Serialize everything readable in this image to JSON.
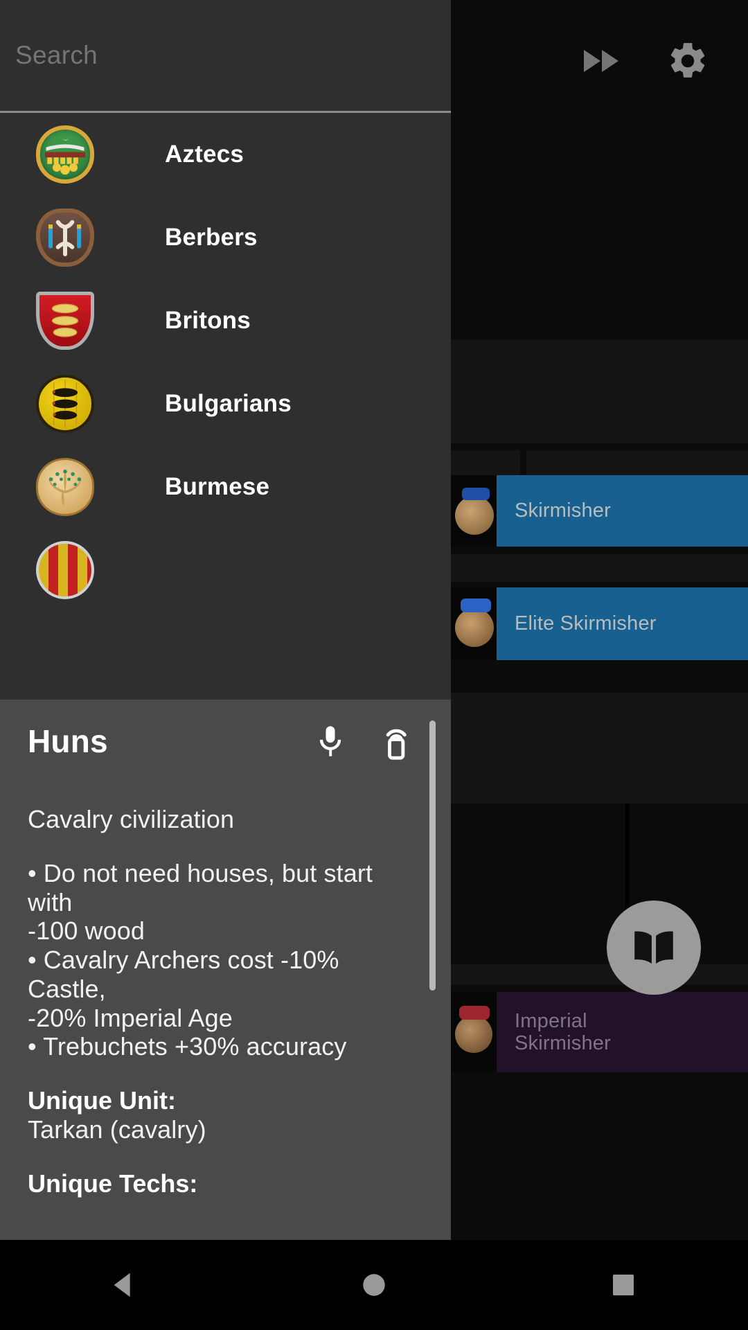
{
  "search": {
    "placeholder": "Search"
  },
  "topbar": {
    "fast_forward_icon": "fast-forward-icon",
    "settings_icon": "gear-icon"
  },
  "civ_list": {
    "items": [
      {
        "label": "Aztecs",
        "emblem": "aztec-shield-icon"
      },
      {
        "label": "Berbers",
        "emblem": "berber-shield-icon"
      },
      {
        "label": "Britons",
        "emblem": "briton-shield-icon"
      },
      {
        "label": "Bulgarians",
        "emblem": "bulgarian-coin-icon"
      },
      {
        "label": "Burmese",
        "emblem": "burmese-peacock-icon"
      }
    ]
  },
  "popup": {
    "title": "Huns",
    "mic_icon": "microphone-icon",
    "cast_icon": "remote-cast-icon",
    "summary": "Cavalry civilization",
    "bonuses": [
      "• Do not need houses, but start with",
      "-100 wood",
      "• Cavalry Archers cost -10% Castle,",
      "-20% Imperial Age",
      "• Trebuchets +30% accuracy"
    ],
    "unique_unit_label": "Unique Unit:",
    "unique_unit_value": "Tarkan (cavalry)",
    "unique_techs_label": "Unique Techs:"
  },
  "tech_tree": {
    "tiles": [
      {
        "label": "Skirmisher",
        "color": "#17608f"
      },
      {
        "label": "Elite Skirmisher",
        "color": "#17608f"
      },
      {
        "label": "Imperial\nSkirmisher",
        "color": "#23112b"
      }
    ]
  },
  "fab": {
    "icon": "book-icon"
  },
  "navbar": {
    "back_icon": "triangle-back-icon",
    "home_icon": "circle-home-icon",
    "recents_icon": "square-recents-icon"
  },
  "colors": {
    "drawer_bg": "#2f2f2f",
    "popup_bg": "#4a4a4a",
    "tile_blue": "#17608f",
    "tile_purple": "#23112b",
    "accent_text": "#ffffff"
  }
}
